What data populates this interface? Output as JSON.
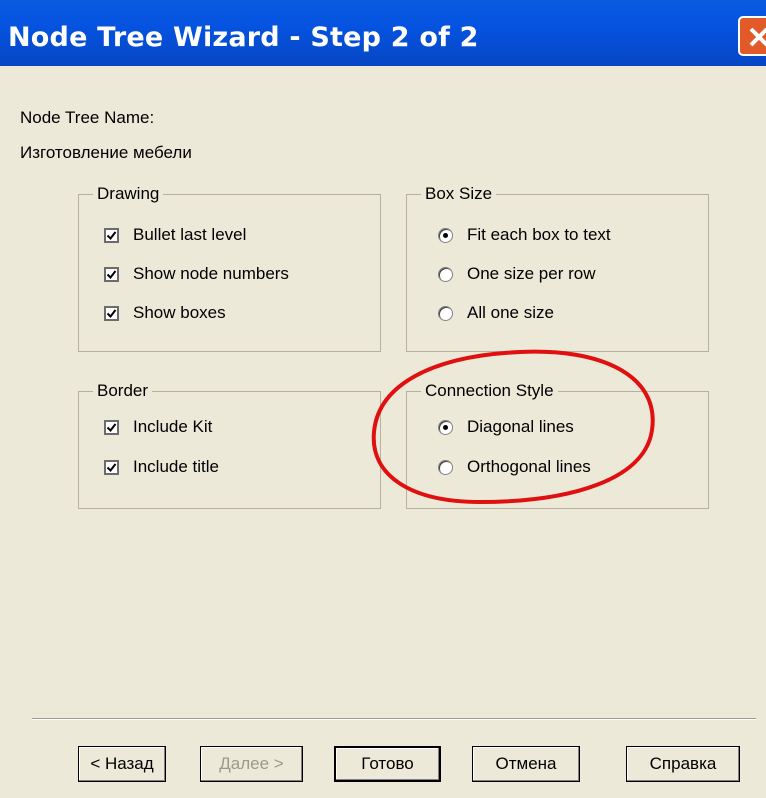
{
  "window": {
    "title": "Node Tree Wizard - Step 2 of 2"
  },
  "node_tree": {
    "label": "Node Tree Name:",
    "value": "Изготовление мебели"
  },
  "drawing": {
    "legend": "Drawing",
    "options": [
      {
        "label": "Bullet last level",
        "checked": true
      },
      {
        "label": "Show node numbers",
        "checked": true
      },
      {
        "label": "Show boxes",
        "checked": true
      }
    ]
  },
  "box_size": {
    "legend": "Box Size",
    "options": [
      {
        "label": "Fit each box to text",
        "selected": true
      },
      {
        "label": "One size per row",
        "selected": false
      },
      {
        "label": "All one size",
        "selected": false
      }
    ]
  },
  "border": {
    "legend": "Border",
    "options": [
      {
        "label": "Include Kit",
        "checked": true
      },
      {
        "label": "Include title",
        "checked": true
      }
    ]
  },
  "connection_style": {
    "legend": "Connection Style",
    "options": [
      {
        "label": "Diagonal lines",
        "selected": true
      },
      {
        "label": "Orthogonal lines",
        "selected": false
      }
    ]
  },
  "buttons": {
    "back": "< Назад",
    "next": "Далее >",
    "finish": "Готово",
    "cancel": "Отмена",
    "help": "Справка"
  },
  "colors": {
    "titlebar": "#0553e0",
    "annotation": "#e01010",
    "face": "#ece9d8"
  }
}
